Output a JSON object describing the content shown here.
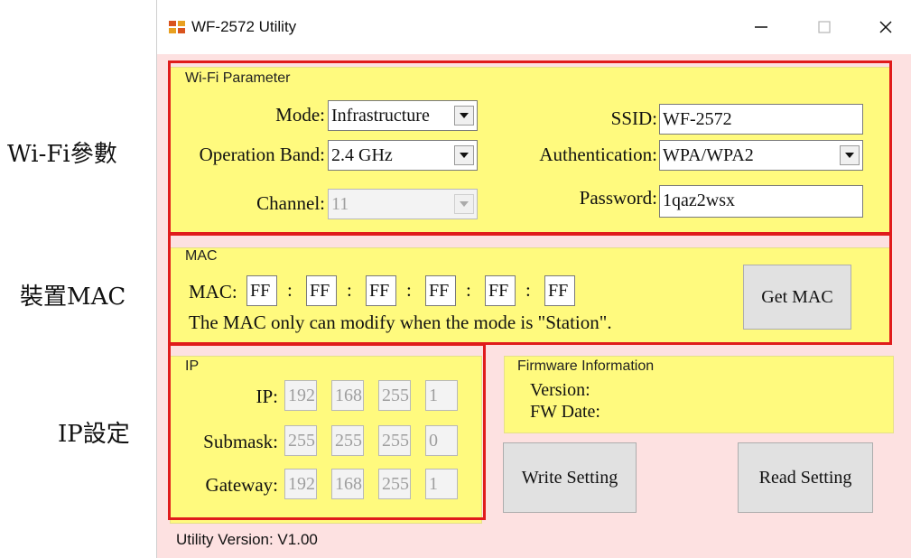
{
  "annotations": {
    "wifi": "Wi-Fi參數",
    "mac": "裝置MAC",
    "ip": "IP設定"
  },
  "window": {
    "title": "WF-2572 Utility",
    "icon": "icpdas-logo-icon",
    "controls": [
      "minimize-icon",
      "maximize-icon",
      "close-icon"
    ]
  },
  "wifi": {
    "legend": "Wi-Fi Parameter",
    "mode_label": "Mode:",
    "mode_value": "Infrastructure",
    "band_label": "Operation Band:",
    "band_value": "2.4 GHz",
    "channel_label": "Channel:",
    "channel_value": "11",
    "ssid_label": "SSID:",
    "ssid_value": "WF-2572",
    "auth_label": "Authentication:",
    "auth_value": "WPA/WPA2",
    "password_label": "Password:",
    "password_value": "1qaz2wsx"
  },
  "mac": {
    "legend": "MAC",
    "label": "MAC:",
    "octets": [
      "FF",
      "FF",
      "FF",
      "FF",
      "FF",
      "FF"
    ],
    "separator": ":",
    "note": "The MAC only can modify when the mode is \"Station\".",
    "button": "Get MAC"
  },
  "ip": {
    "legend": "IP",
    "ip_label": "IP:",
    "ip": [
      "192",
      "168",
      "255",
      "1"
    ],
    "mask_label": "Submask:",
    "mask": [
      "255",
      "255",
      "255",
      "0"
    ],
    "gw_label": "Gateway:",
    "gw": [
      "192",
      "168",
      "255",
      "1"
    ]
  },
  "firmware": {
    "legend": "Firmware Information",
    "version_label": "Version:",
    "date_label": "FW Date:"
  },
  "buttons": {
    "write": "Write Setting",
    "read": "Read Setting"
  },
  "footer": "Utility Version: V1.00",
  "colors": {
    "panel": "#fffa7e",
    "window_bg": "#fde1e1",
    "highlight": "#e01b1b"
  }
}
